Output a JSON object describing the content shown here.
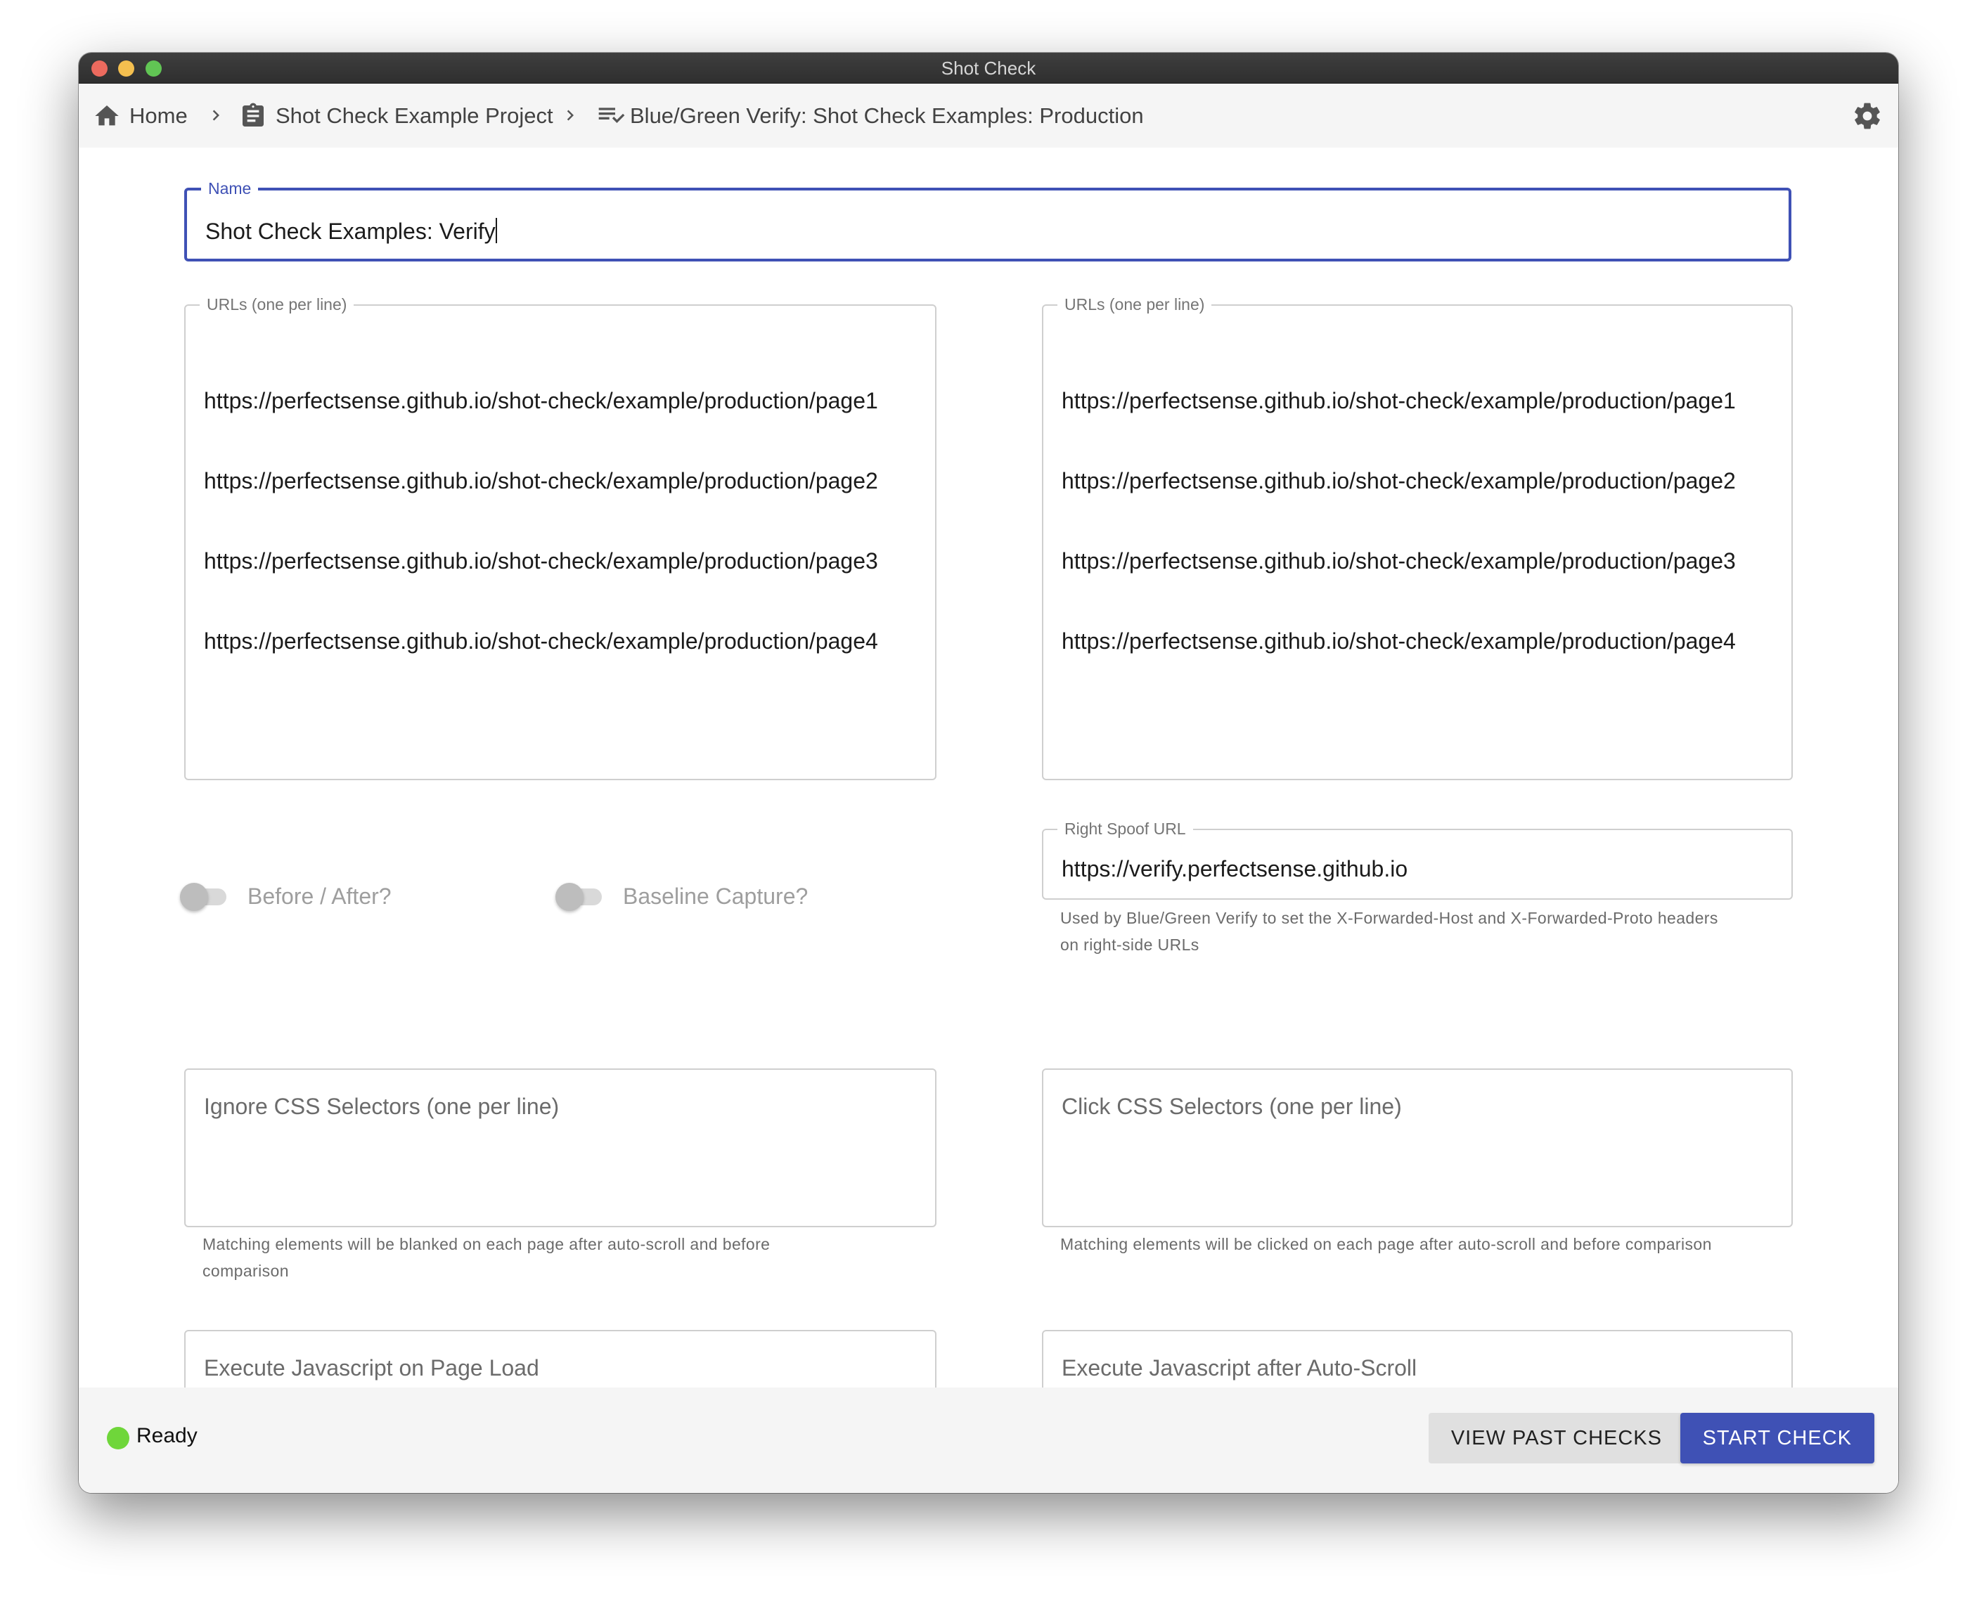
{
  "window": {
    "title": "Shot Check"
  },
  "breadcrumb": {
    "home": "Home",
    "project": "Shot Check Example Project",
    "check": "Blue/Green Verify: Shot Check Examples: Production"
  },
  "form": {
    "name": {
      "label": "Name",
      "value": "Shot Check Examples: Verify"
    },
    "left_urls": {
      "label": "URLs (one per line)",
      "lines": [
        "https://perfectsense.github.io/shot-check/example/production/page1",
        "https://perfectsense.github.io/shot-check/example/production/page2",
        "https://perfectsense.github.io/shot-check/example/production/page3",
        "https://perfectsense.github.io/shot-check/example/production/page4"
      ]
    },
    "right_urls": {
      "label": "URLs (one per line)",
      "lines": [
        "https://perfectsense.github.io/shot-check/example/production/page1",
        "https://perfectsense.github.io/shot-check/example/production/page2",
        "https://perfectsense.github.io/shot-check/example/production/page3",
        "https://perfectsense.github.io/shot-check/example/production/page4"
      ]
    },
    "toggles": {
      "before_after": {
        "label": "Before / After?",
        "checked": false
      },
      "baseline": {
        "label": "Baseline Capture?",
        "checked": false
      }
    },
    "spoof": {
      "label": "Right Spoof URL",
      "value": "https://verify.perfectsense.github.io",
      "helper_line1": "Used by Blue/Green Verify to set the X-Forwarded-Host and X-Forwarded-Proto headers",
      "helper_line2": "on right-side URLs"
    },
    "ignore_css": {
      "placeholder": "Ignore CSS Selectors (one per line)",
      "helper_line1": "Matching elements will be blanked on each page after auto-scroll and before",
      "helper_line2": "comparison"
    },
    "click_css": {
      "placeholder": "Click CSS Selectors (one per line)",
      "helper": "Matching elements will be clicked on each page after auto-scroll and before comparison"
    },
    "js_load": {
      "placeholder": "Execute Javascript on Page Load"
    },
    "js_scroll": {
      "placeholder": "Execute Javascript after Auto-Scroll"
    }
  },
  "status": {
    "text": "Ready",
    "color": "#6fd63a"
  },
  "actions": {
    "view_past": "VIEW PAST CHECKS",
    "start": "START CHECK"
  },
  "colors": {
    "accent": "#3f51b5"
  },
  "icons": [
    "home-icon",
    "clipboard-icon",
    "playlist-check-icon",
    "chevron-right-icon",
    "gear-icon"
  ]
}
